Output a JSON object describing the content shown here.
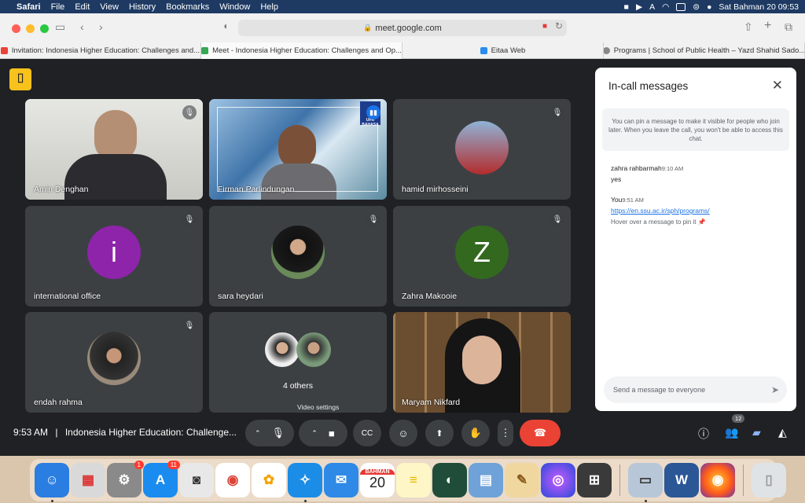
{
  "menubar": {
    "app": "Safari",
    "items": [
      "File",
      "Edit",
      "View",
      "History",
      "Bookmarks",
      "Window",
      "Help"
    ],
    "datetime": "Sat Bahman 20  09:53"
  },
  "browser": {
    "url": "meet.google.com",
    "tabs": [
      {
        "label": "Invitation: Indonesia Higher Education: Challenges and..."
      },
      {
        "label": "Meet - Indonesia Higher Education: Challenges and Op..."
      },
      {
        "label": "Eitaa Web"
      },
      {
        "label": "Programs | School of Public Health – Yazd Shahid Sado..."
      }
    ]
  },
  "tiles": [
    {
      "name": "Amin Denghan",
      "muted": true,
      "type": "video"
    },
    {
      "name": "Firman Parlindungan",
      "muted": false,
      "type": "video",
      "speaking": true
    },
    {
      "name": "hamid mirhosseini",
      "muted": true,
      "type": "photo"
    },
    {
      "name": "international office",
      "muted": true,
      "type": "letter",
      "letter": "i",
      "color": "#8e24aa"
    },
    {
      "name": "sara heydari",
      "muted": true,
      "type": "photo"
    },
    {
      "name": "Zahra Makooie",
      "muted": true,
      "type": "letter",
      "letter": "Z",
      "color": "#33691e"
    },
    {
      "name": "endah rahma",
      "muted": true,
      "type": "photo"
    },
    {
      "name": "4 others",
      "type": "group"
    },
    {
      "name": "Maryam Nikfard",
      "type": "video"
    }
  ],
  "tile_badge": "UPA BAHASA",
  "chat": {
    "title": "In-call messages",
    "info": "You can pin a message to make it visible for people who join later. When you leave the call, you won't be able to access this chat.",
    "messages": [
      {
        "sender": "zahra rahbarmah",
        "time": "9:10 AM",
        "text": "yes"
      },
      {
        "sender": "You",
        "time": "9:51 AM",
        "link": "https://en.ssu.ac.ir/sph/programs/",
        "hint": "Hover over a message to pin it"
      }
    ],
    "placeholder": "Send a message to everyone"
  },
  "controls": {
    "time": "9:53 AM",
    "meeting_title": "Indonesia Higher Education: Challenge...",
    "tooltip": "Video settings",
    "people_count": "12"
  },
  "dock": {
    "calendar_month": "BAHMAN",
    "calendar_day": "20",
    "system_prefs_badge": "1",
    "appstore_badge": "11"
  }
}
